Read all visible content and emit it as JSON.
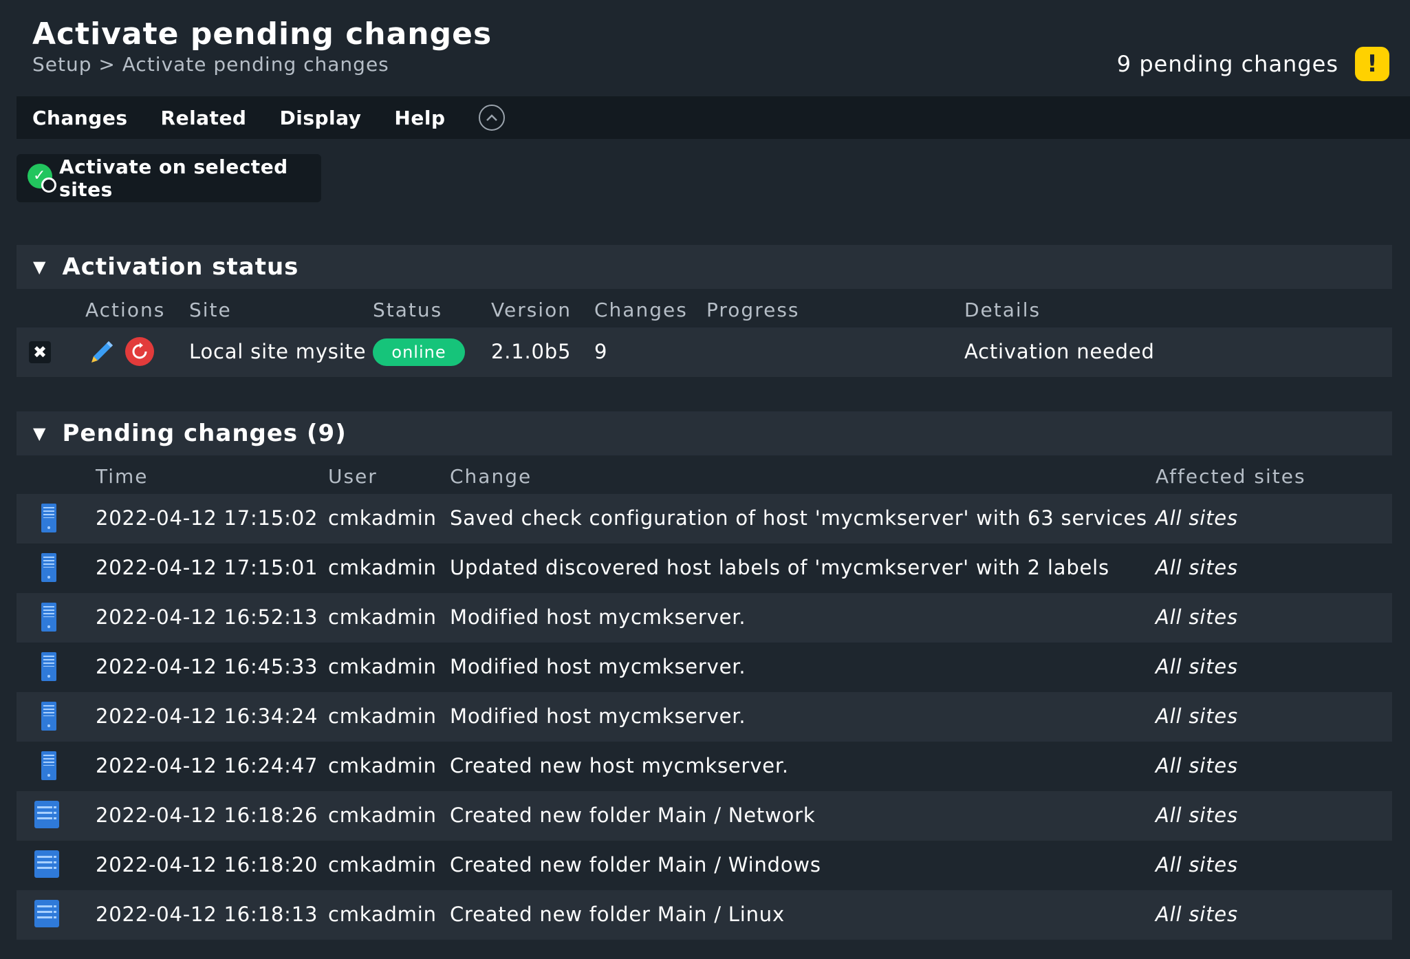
{
  "header": {
    "title": "Activate pending changes",
    "breadcrumb": "Setup > Activate pending changes",
    "pending_text": "9 pending changes",
    "warning_symbol": "!"
  },
  "menu": {
    "items": [
      "Changes",
      "Related",
      "Display",
      "Help"
    ],
    "collapse_symbol": "^"
  },
  "actions": {
    "activate_label": "Activate on selected sites"
  },
  "activation_status": {
    "title": "Activation status",
    "columns": [
      "Actions",
      "Site",
      "Status",
      "Version",
      "Changes",
      "Progress",
      "Details"
    ],
    "row": {
      "site": "Local site mysite",
      "status": "online",
      "version": "2.1.0b5",
      "changes": "9",
      "progress": "",
      "details": "Activation needed"
    }
  },
  "pending_changes": {
    "title": "Pending changes (9)",
    "columns": [
      "Time",
      "User",
      "Change",
      "Affected sites"
    ],
    "rows": [
      {
        "icon": "host-icon",
        "time": "2022-04-12 17:15:02",
        "user": "cmkadmin",
        "change": "Saved check configuration of host 'mycmkserver' with 63 services",
        "sites": "All sites"
      },
      {
        "icon": "host-icon",
        "time": "2022-04-12 17:15:01",
        "user": "cmkadmin",
        "change": "Updated discovered host labels of 'mycmkserver' with 2 labels",
        "sites": "All sites"
      },
      {
        "icon": "host-icon",
        "time": "2022-04-12 16:52:13",
        "user": "cmkadmin",
        "change": "Modified host mycmkserver.",
        "sites": "All sites"
      },
      {
        "icon": "host-icon",
        "time": "2022-04-12 16:45:33",
        "user": "cmkadmin",
        "change": "Modified host mycmkserver.",
        "sites": "All sites"
      },
      {
        "icon": "host-icon",
        "time": "2022-04-12 16:34:24",
        "user": "cmkadmin",
        "change": "Modified host mycmkserver.",
        "sites": "All sites"
      },
      {
        "icon": "host-icon",
        "time": "2022-04-12 16:24:47",
        "user": "cmkadmin",
        "change": "Created new host mycmkserver.",
        "sites": "All sites"
      },
      {
        "icon": "folder-icon",
        "time": "2022-04-12 16:18:26",
        "user": "cmkadmin",
        "change": "Created new folder Main / Network",
        "sites": "All sites"
      },
      {
        "icon": "folder-icon",
        "time": "2022-04-12 16:18:20",
        "user": "cmkadmin",
        "change": "Created new folder Main / Windows",
        "sites": "All sites"
      },
      {
        "icon": "folder-icon",
        "time": "2022-04-12 16:18:13",
        "user": "cmkadmin",
        "change": "Created new folder Main / Linux",
        "sites": "All sites"
      }
    ]
  },
  "colors": {
    "background": "#1e262e",
    "menubar": "#131a20",
    "online": "#16c47a",
    "warning": "#ffd100",
    "restart": "#e23b3b",
    "icon_blue": "#2f7ad9"
  }
}
